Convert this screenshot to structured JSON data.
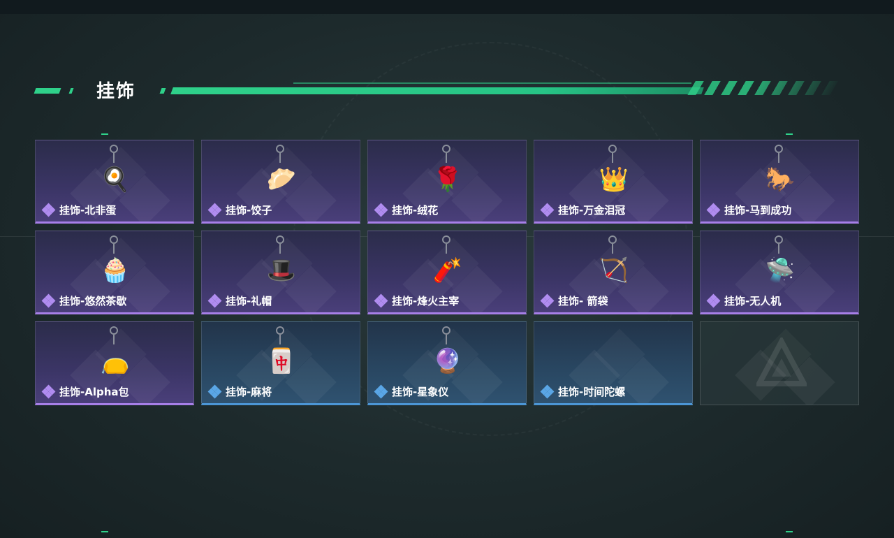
{
  "section": {
    "title": "挂饰"
  },
  "colors": {
    "accent": "#2fd18a",
    "rarity_purple": "#a77fe8",
    "rarity_blue": "#4c96d6"
  },
  "items": [
    {
      "label": "挂饰-北非蛋",
      "rarity": "purple",
      "icon": "shakshuka-pan-icon",
      "glyph": "🍳"
    },
    {
      "label": "挂饰-饺子",
      "rarity": "purple",
      "icon": "dumpling-plate-icon",
      "glyph": "🥟"
    },
    {
      "label": "挂饰-绒花",
      "rarity": "purple",
      "icon": "velvet-flower-icon",
      "glyph": "🌹"
    },
    {
      "label": "挂饰-万金泪冠",
      "rarity": "purple",
      "icon": "jeweled-crown-icon",
      "glyph": "👑"
    },
    {
      "label": "挂饰-马到成功",
      "rarity": "purple",
      "icon": "red-horse-icon",
      "glyph": "🐎"
    },
    {
      "label": "挂饰-悠然茶歇",
      "rarity": "purple",
      "icon": "cupcake-icon",
      "glyph": "🧁"
    },
    {
      "label": "挂饰-礼帽",
      "rarity": "purple",
      "icon": "fedora-hat-icon",
      "glyph": "🎩"
    },
    {
      "label": "挂饰-烽火主宰",
      "rarity": "purple",
      "icon": "graffiti-container-icon",
      "glyph": "🧨"
    },
    {
      "label": "挂饰- 箭袋",
      "rarity": "purple",
      "icon": "quiver-icon",
      "glyph": "🏹"
    },
    {
      "label": "挂饰-无人机",
      "rarity": "purple",
      "icon": "drone-icon",
      "glyph": "🛸"
    },
    {
      "label": "挂饰-Alpha包",
      "rarity": "purple",
      "icon": "alpha-pouch-icon",
      "glyph": "👝"
    },
    {
      "label": "挂饰-麻将",
      "rarity": "blue",
      "icon": "mahjong-tile-icon",
      "glyph": "🀄"
    },
    {
      "label": "挂饰-星象仪",
      "rarity": "blue",
      "icon": "astrolabe-icon",
      "glyph": "🔮"
    },
    {
      "label": "挂饰-时间陀螺",
      "rarity": "blue",
      "icon": "",
      "glyph": ""
    },
    {
      "label": "",
      "rarity": "empty",
      "icon": "empty-slot-logo-icon",
      "glyph": ""
    }
  ]
}
